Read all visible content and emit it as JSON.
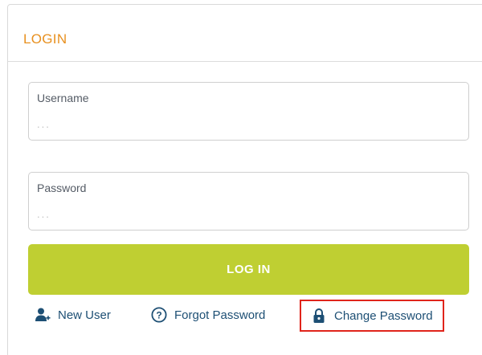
{
  "login": {
    "title": "LOGIN",
    "username": {
      "label": "Username",
      "placeholder": "..."
    },
    "password": {
      "label": "Password",
      "placeholder": "..."
    },
    "submit_label": "LOG IN",
    "links": {
      "new_user": "New User",
      "forgot_password": "Forgot Password",
      "change_password": "Change Password"
    }
  },
  "colors": {
    "title": "#e8901f",
    "button": "#bfcf32",
    "link": "#1d4f74",
    "highlight": "#e0241b"
  },
  "icons": {
    "new_user": "add-user-icon",
    "forgot_password": "question-circle-icon",
    "change_password": "lock-icon"
  }
}
